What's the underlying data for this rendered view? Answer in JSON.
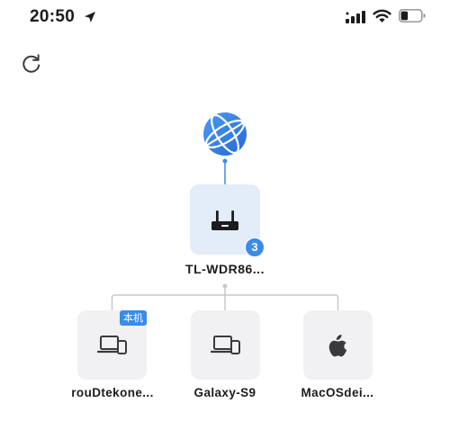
{
  "status_bar": {
    "time": "20:50",
    "icons": [
      "location-arrow-icon",
      "signal-icon",
      "wifi-icon",
      "battery-icon"
    ],
    "battery_level": 0.35
  },
  "toolbar": {
    "refresh_icon": "refresh-icon"
  },
  "topology": {
    "internet_icon": "globe-icon",
    "router": {
      "name": "TL-WDR86...",
      "icon": "router-icon",
      "connected_count": "3"
    },
    "devices": [
      {
        "name": "rouDtekone...",
        "icon": "laptop-phone-icon",
        "tag": "本机"
      },
      {
        "name": "Galaxy-S9",
        "icon": "laptop-phone-icon"
      },
      {
        "name": "MacOSdei...",
        "icon": "apple-icon"
      }
    ]
  },
  "colors": {
    "accent": "#3a8bea",
    "router_bg": "#e3edf9",
    "device_bg": "#f1f1f3",
    "connector": "#c8c8cc",
    "text": "#1c1c1e"
  }
}
